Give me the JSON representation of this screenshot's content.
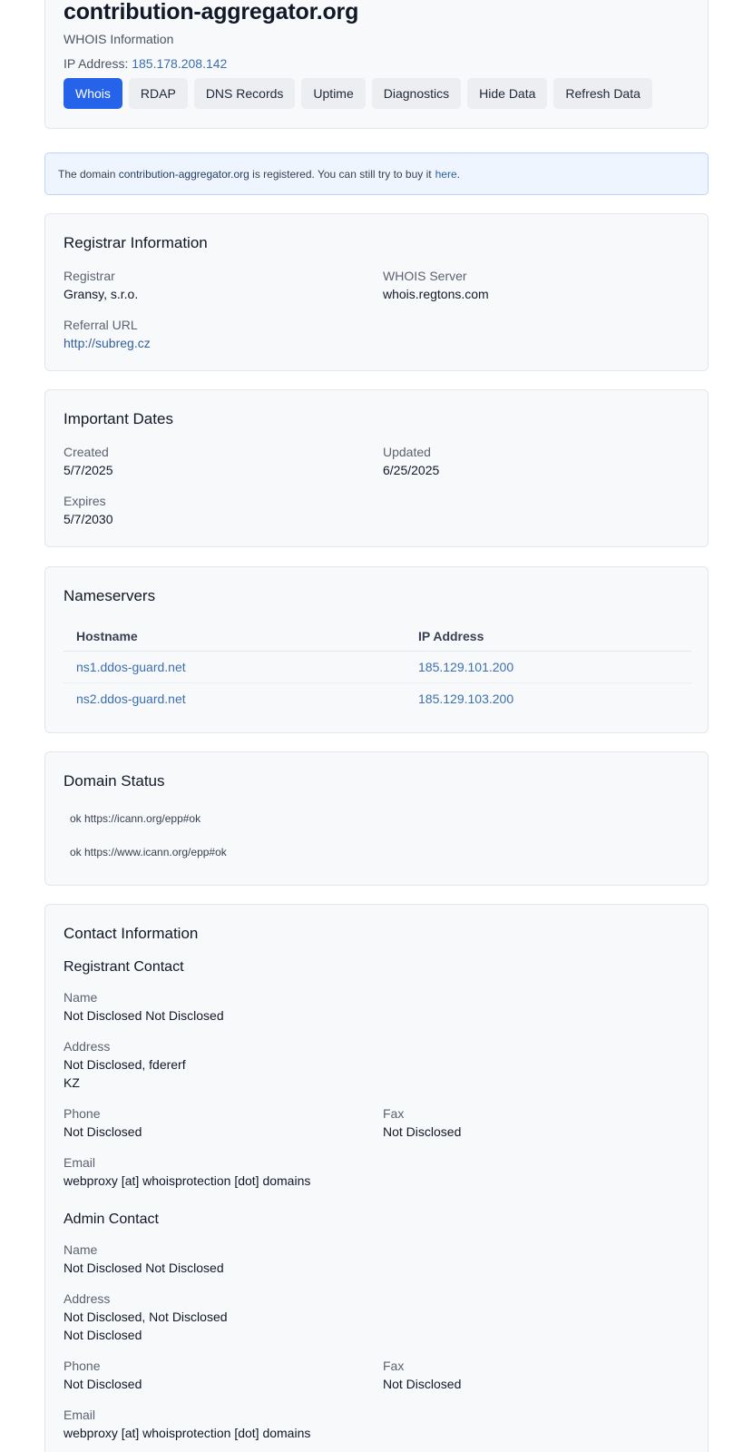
{
  "header": {
    "domain": "contribution-aggregator.org",
    "subtitle": "WHOIS Information",
    "ip_label": "IP Address:",
    "ip_value": "185.178.208.142",
    "tabs": [
      {
        "label": "Whois",
        "active": true
      },
      {
        "label": "RDAP",
        "active": false
      },
      {
        "label": "DNS Records",
        "active": false
      },
      {
        "label": "Uptime",
        "active": false
      },
      {
        "label": "Diagnostics",
        "active": false
      },
      {
        "label": "Hide Data",
        "active": false
      },
      {
        "label": "Refresh Data",
        "active": false
      }
    ]
  },
  "alert": {
    "prefix": "The domain",
    "domain": "contribution-aggregator.org",
    "middle": "is registered. You can still try to buy it",
    "link": "here",
    "suffix": "."
  },
  "registrar": {
    "title": "Registrar Information",
    "registrar_label": "Registrar",
    "registrar_value": "Gransy, s.r.o.",
    "whois_label": "WHOIS Server",
    "whois_value": "whois.regtons.com",
    "referral_label": "Referral URL",
    "referral_value": "http://subreg.cz"
  },
  "dates": {
    "title": "Important Dates",
    "created_label": "Created",
    "created_value": "5/7/2025",
    "updated_label": "Updated",
    "updated_value": "6/25/2025",
    "expires_label": "Expires",
    "expires_value": "5/7/2030"
  },
  "nameservers": {
    "title": "Nameservers",
    "col_hostname": "Hostname",
    "col_ip": "IP Address",
    "rows": [
      {
        "host": "ns1.ddos-guard.net",
        "ip": "185.129.101.200"
      },
      {
        "host": "ns2.ddos-guard.net",
        "ip": "185.129.103.200"
      }
    ]
  },
  "status": {
    "title": "Domain Status",
    "items": [
      "ok https://icann.org/epp#ok",
      "ok https://www.icann.org/epp#ok"
    ]
  },
  "contact": {
    "title": "Contact Information",
    "registrant": {
      "title": "Registrant Contact",
      "name_label": "Name",
      "name_value": "Not Disclosed Not Disclosed",
      "address_label": "Address",
      "address_line1": "Not Disclosed, fdererf",
      "address_line2": "KZ",
      "phone_label": "Phone",
      "phone_value": "Not Disclosed",
      "fax_label": "Fax",
      "fax_value": "Not Disclosed",
      "email_label": "Email",
      "email_value": "webproxy [at] whoisprotection [dot] domains"
    },
    "admin": {
      "title": "Admin Contact",
      "name_label": "Name",
      "name_value": "Not Disclosed Not Disclosed",
      "address_label": "Address",
      "address_line1": "Not Disclosed, Not Disclosed",
      "address_line2": "Not Disclosed",
      "phone_label": "Phone",
      "phone_value": "Not Disclosed",
      "fax_label": "Fax",
      "fax_value": "Not Disclosed",
      "email_label": "Email",
      "email_value": "webproxy [at] whoisprotection [dot] domains"
    }
  },
  "colors": {
    "accent": "#2563eb",
    "link": "#3b6fb0",
    "card_bg": "#f8f9fb",
    "alert_bg": "#eef5ff"
  }
}
